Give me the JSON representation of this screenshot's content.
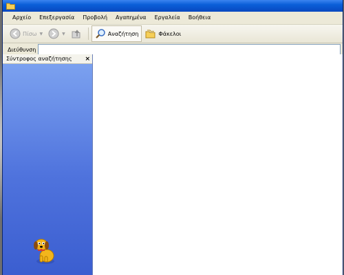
{
  "menu": [
    "Αρχείο",
    "Επεξεργασία",
    "Προβολή",
    "Αγαπημένα",
    "Εργαλεία",
    "Βοήθεια"
  ],
  "toolbar": {
    "back_label": "Πίσω",
    "search_label": "Αναζήτηση",
    "folders_label": "Φάκελοι"
  },
  "address": {
    "label": "Διεύθυνση",
    "value": ""
  },
  "search_pane": {
    "title": "Σύντροφος αναζήτησης",
    "close": "×"
  },
  "colors": {
    "titlebar": "#0a5fd8",
    "pane": "#4f73dd"
  }
}
